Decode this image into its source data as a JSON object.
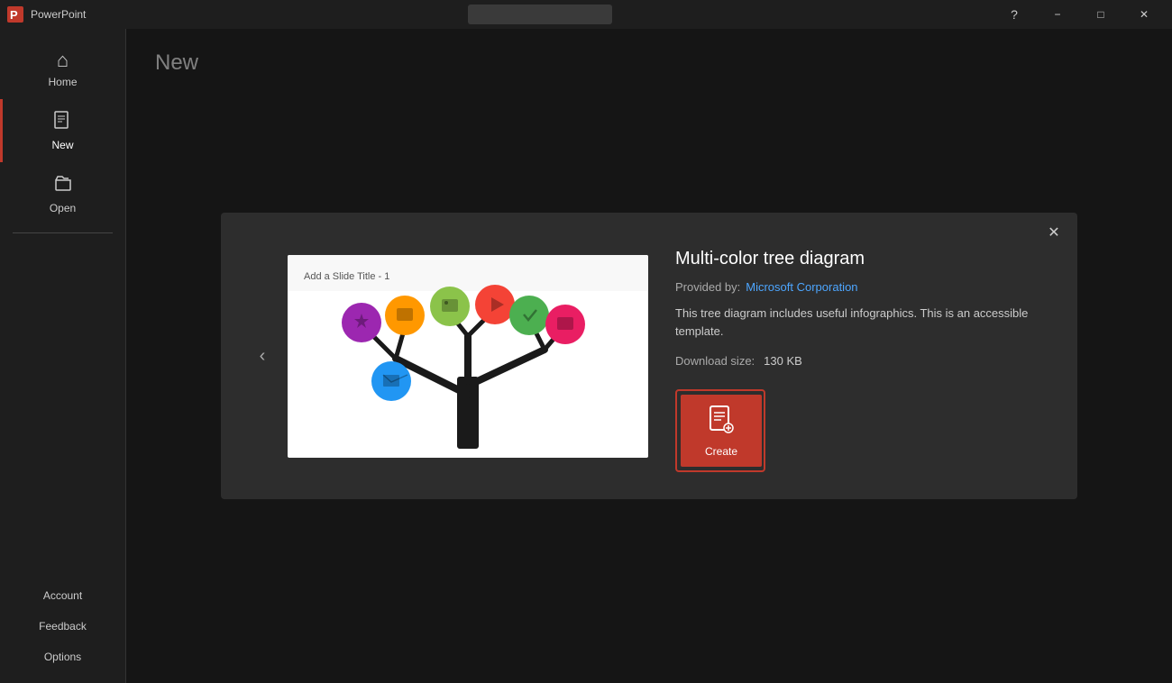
{
  "titlebar": {
    "app_name": "PowerPoint",
    "minimize_label": "−",
    "maximize_label": "□",
    "close_label": "✕"
  },
  "sidebar": {
    "items": [
      {
        "id": "home",
        "label": "Home",
        "icon": "⌂"
      },
      {
        "id": "new",
        "label": "New",
        "icon": "⬜",
        "active": true
      },
      {
        "id": "open",
        "label": "Open",
        "icon": "📁"
      }
    ],
    "bottom_items": [
      {
        "id": "account",
        "label": "Account"
      },
      {
        "id": "feedback",
        "label": "Feedback"
      },
      {
        "id": "options",
        "label": "Options"
      }
    ]
  },
  "content": {
    "page_title": "New"
  },
  "modal": {
    "close_label": "✕",
    "template_name": "Multi-color tree diagram",
    "provided_by_label": "Provided by:",
    "provided_by_value": "Microsoft Corporation",
    "description": "This tree diagram includes useful infographics. This is an accessible template.",
    "download_label": "Download size:",
    "download_value": "130 KB",
    "slide_title": "Add a Slide Title - 1",
    "create_label": "Create",
    "back_arrow": "‹",
    "nav_hidden": true
  },
  "colors": {
    "accent": "#c0392b",
    "link": "#4da6ff",
    "sidebar_bg": "#1e1e1e",
    "content_bg": "#2b2b2b",
    "modal_bg": "#2d2d2d"
  }
}
